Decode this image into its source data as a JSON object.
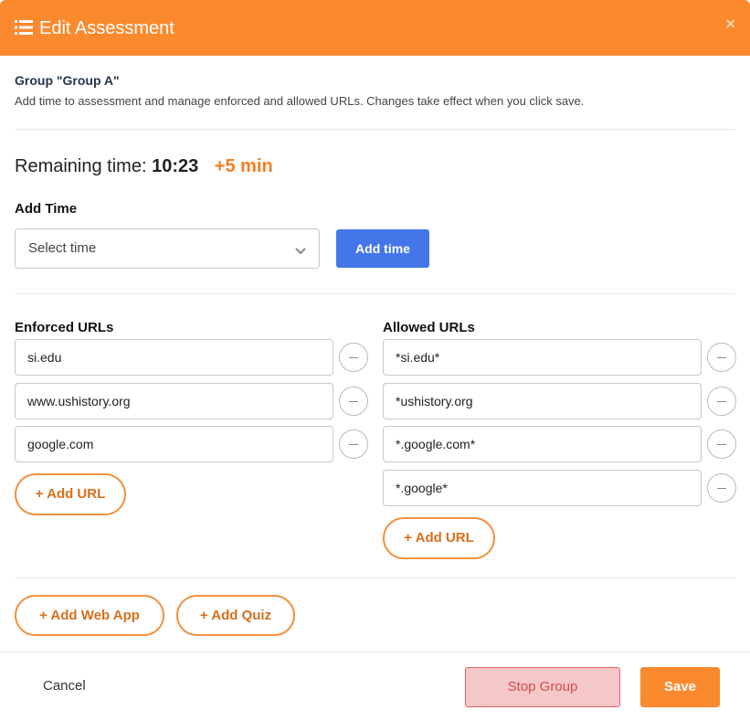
{
  "header": {
    "title": "Edit Assessment",
    "icon": "list-icon",
    "close_icon": "close-icon",
    "close_glyph": "×"
  },
  "group": {
    "title": "Group \"Group A\"",
    "description": "Add time to assessment and manage enforced and allowed URLs. Changes take effect when you click save."
  },
  "remaining": {
    "label": "Remaining time:",
    "time": "10:23",
    "added": "+5 min"
  },
  "add_time": {
    "label": "Add Time",
    "select_placeholder": "Select time",
    "button_label": "Add time"
  },
  "enforced": {
    "label": "Enforced URLs",
    "urls": [
      "si.edu",
      "www.ushistory.org",
      "google.com"
    ],
    "add_label": "+ Add URL"
  },
  "allowed": {
    "label": "Allowed URLs",
    "urls": [
      "*si.edu*",
      "*ushistory.org",
      "*.google.com*",
      "*.google*"
    ],
    "add_label": "+ Add URL"
  },
  "extras": {
    "add_web_app": "+ Add Web App",
    "add_quiz": "+ Add Quiz"
  },
  "footer": {
    "cancel": "Cancel",
    "stop_group": "Stop Group",
    "save": "Save"
  },
  "colors": {
    "accent": "#fb8a2e",
    "primary_blue": "#4476ea",
    "danger_bg": "#f4c7c8",
    "danger_text": "#d74b4e"
  }
}
